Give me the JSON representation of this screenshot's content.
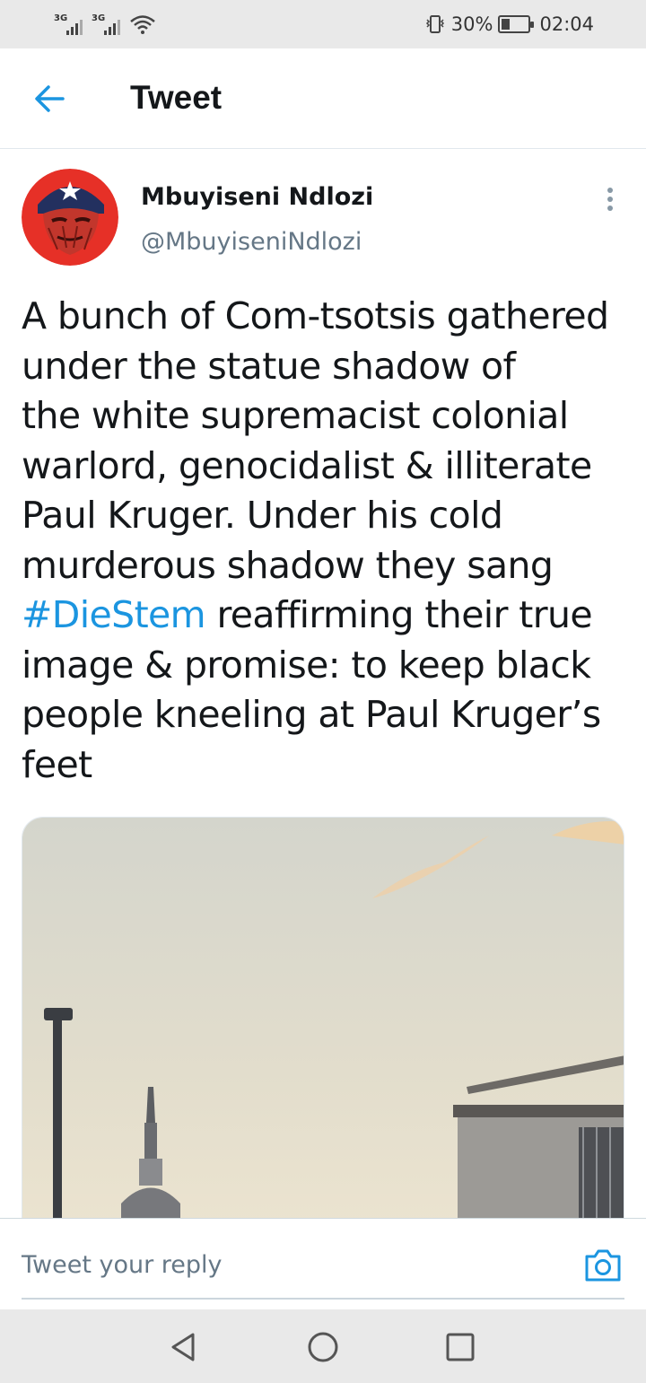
{
  "status_bar": {
    "signal1_label": "3G",
    "signal2_label": "3G",
    "battery_percent": "30%",
    "battery_level": 0.3,
    "time": "02:04"
  },
  "header": {
    "title": "Tweet"
  },
  "tweet": {
    "author_name": "Mbuyiseni Ndlozi",
    "author_handle": "@MbuyiseniNdlozi",
    "text_lines": [
      "A bunch of Com-tsotsis gathered",
      "under the statue shadow of",
      "the white supremacist colonial",
      "warlord, genocidalist & illiterate",
      "Paul Kruger. Under his cold",
      "murderous shadow they sang",
      "reaffirming their true",
      "image & promise: to keep black",
      "people kneeling at Paul Kruger’s",
      "feet"
    ],
    "hashtag": "#DieStem"
  },
  "reply": {
    "placeholder": "Tweet your reply"
  },
  "icons": {
    "back": "arrow-left-icon",
    "more": "more-vertical-icon",
    "camera": "camera-icon",
    "nav_back": "triangle-back-icon",
    "nav_home": "circle-home-icon",
    "nav_recent": "square-recents-icon"
  },
  "colors": {
    "accent": "#1b95e0",
    "text": "#14171a",
    "secondary": "#657786",
    "system_bar": "#e9e9e9"
  }
}
